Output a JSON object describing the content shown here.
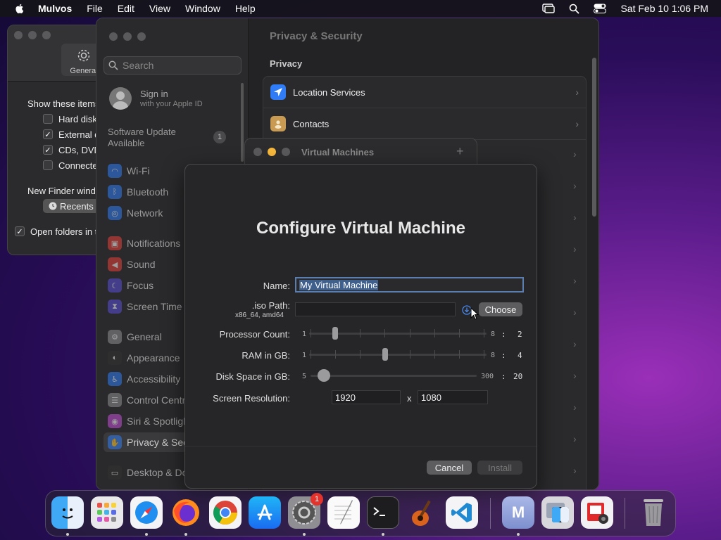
{
  "menubar": {
    "app_name": "Mulvos",
    "items": [
      "File",
      "Edit",
      "View",
      "Window",
      "Help"
    ],
    "clock": "Sat Feb 10  1:06 PM"
  },
  "finder": {
    "tab_general": "General",
    "show_items_label": "Show these items on the desktop:",
    "opt_hard_disks": "Hard disks",
    "opt_external": "External disks",
    "opt_cds": "CDs, DVDs, and iPods",
    "opt_connected": "Connected servers",
    "new_window_label": "New Finder windows show:",
    "new_window_value": "Recents",
    "open_folders": "Open folders in tabs instead of new windows"
  },
  "settings": {
    "search_placeholder": "Search",
    "signin_title": "Sign in",
    "signin_sub": "with your Apple ID",
    "software_update": "Software Update Available",
    "software_update_count": "1",
    "sidebar": [
      {
        "label": "Wi-Fi",
        "color": "#2f7cf6"
      },
      {
        "label": "Bluetooth",
        "color": "#2f7cf6"
      },
      {
        "label": "Network",
        "color": "#2f7cf6"
      },
      {
        "label": "Notifications",
        "color": "#e8403a"
      },
      {
        "label": "Sound",
        "color": "#e8403a"
      },
      {
        "label": "Focus",
        "color": "#5a4fd8"
      },
      {
        "label": "Screen Time",
        "color": "#5a4fd8"
      },
      {
        "label": "General",
        "color": "#8e8e93"
      },
      {
        "label": "Appearance",
        "color": "#333333"
      },
      {
        "label": "Accessibility",
        "color": "#2f7cf6"
      },
      {
        "label": "Control Centre",
        "color": "#8e8e93"
      },
      {
        "label": "Siri & Spotlight",
        "color": "#c450d8"
      },
      {
        "label": "Privacy & Security",
        "color": "#2f7cf6"
      },
      {
        "label": "Desktop & Dock",
        "color": "#333333"
      }
    ],
    "content_title": "Privacy & Security",
    "section": "Privacy",
    "rows": [
      {
        "label": "Location Services"
      },
      {
        "label": "Contacts"
      }
    ]
  },
  "vm_window": {
    "title": "Virtual Machines",
    "add": "+"
  },
  "dialog": {
    "title": "Configure Virtual Machine",
    "name_label": "Name:",
    "name_value": "My Virtual Machine",
    "iso_label": ".iso Path:",
    "iso_sub": "x86_64, amd64",
    "choose": "Choose",
    "cpu_label": "Processor Count:",
    "cpu_min": "1",
    "cpu_max": "8",
    "cpu_value": "2",
    "ram_label": "RAM in GB:",
    "ram_min": "1",
    "ram_max": "8",
    "ram_value": "4",
    "disk_label": "Disk Space in GB:",
    "disk_min": "5",
    "disk_max": "300",
    "disk_value": "20",
    "res_label": "Screen Resolution:",
    "res_width": "1920",
    "res_x": "x",
    "res_height": "1080",
    "colon": ":",
    "cancel": "Cancel",
    "install": "Install"
  },
  "dock": {
    "settings_badge": "1",
    "mulvos_letter": "M"
  }
}
